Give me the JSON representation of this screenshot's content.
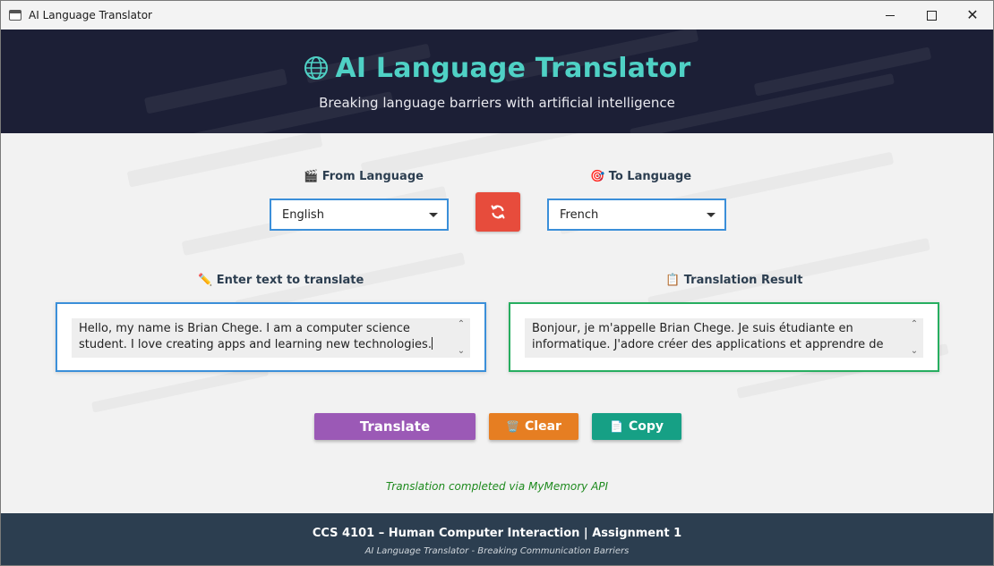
{
  "window": {
    "title": "AI Language Translator"
  },
  "header": {
    "title": "AI Language Translator",
    "subtitle": "Breaking language barriers with artificial intelligence"
  },
  "from": {
    "label": "🎬 From Language",
    "selected": "English"
  },
  "to": {
    "label": "🎯 To Language",
    "selected": "French"
  },
  "input": {
    "label": "✏️ Enter text to translate",
    "value": "Hello, my name is Brian Chege. I am a computer science student. I love creating apps and learning new technologies."
  },
  "output": {
    "label": "📋 Translation Result",
    "value": "Bonjour, je m'appelle Brian Chege. Je suis étudiante en informatique. J'adore créer des applications et apprendre de"
  },
  "buttons": {
    "translate": "Translate",
    "clear": "Clear",
    "clear_icon": "🗑️",
    "copy": "Copy",
    "copy_icon": "📄"
  },
  "status": "Translation completed via MyMemory API",
  "footer": {
    "line1": "CCS 4101 – Human Computer Interaction | Assignment 1",
    "line2": "AI Language Translator - Breaking Communication Barriers"
  },
  "colors": {
    "header_bg": "#1c1f36",
    "title_accent": "#4fd1c5",
    "swap_button": "#e74c3c",
    "translate_button": "#9b59b6",
    "clear_button": "#e67e22",
    "copy_button": "#16a085",
    "input_border": "#3b8fd9",
    "output_border": "#27ae60",
    "status_text": "#1e8a1e",
    "footer_bg": "#2c3e50"
  },
  "icons": {
    "app": "window-app-icon",
    "globe": "globe-icon",
    "swap": "swap-arrows-icon",
    "minimize": "minimize-icon",
    "maximize": "maximize-icon",
    "close": "close-icon"
  }
}
